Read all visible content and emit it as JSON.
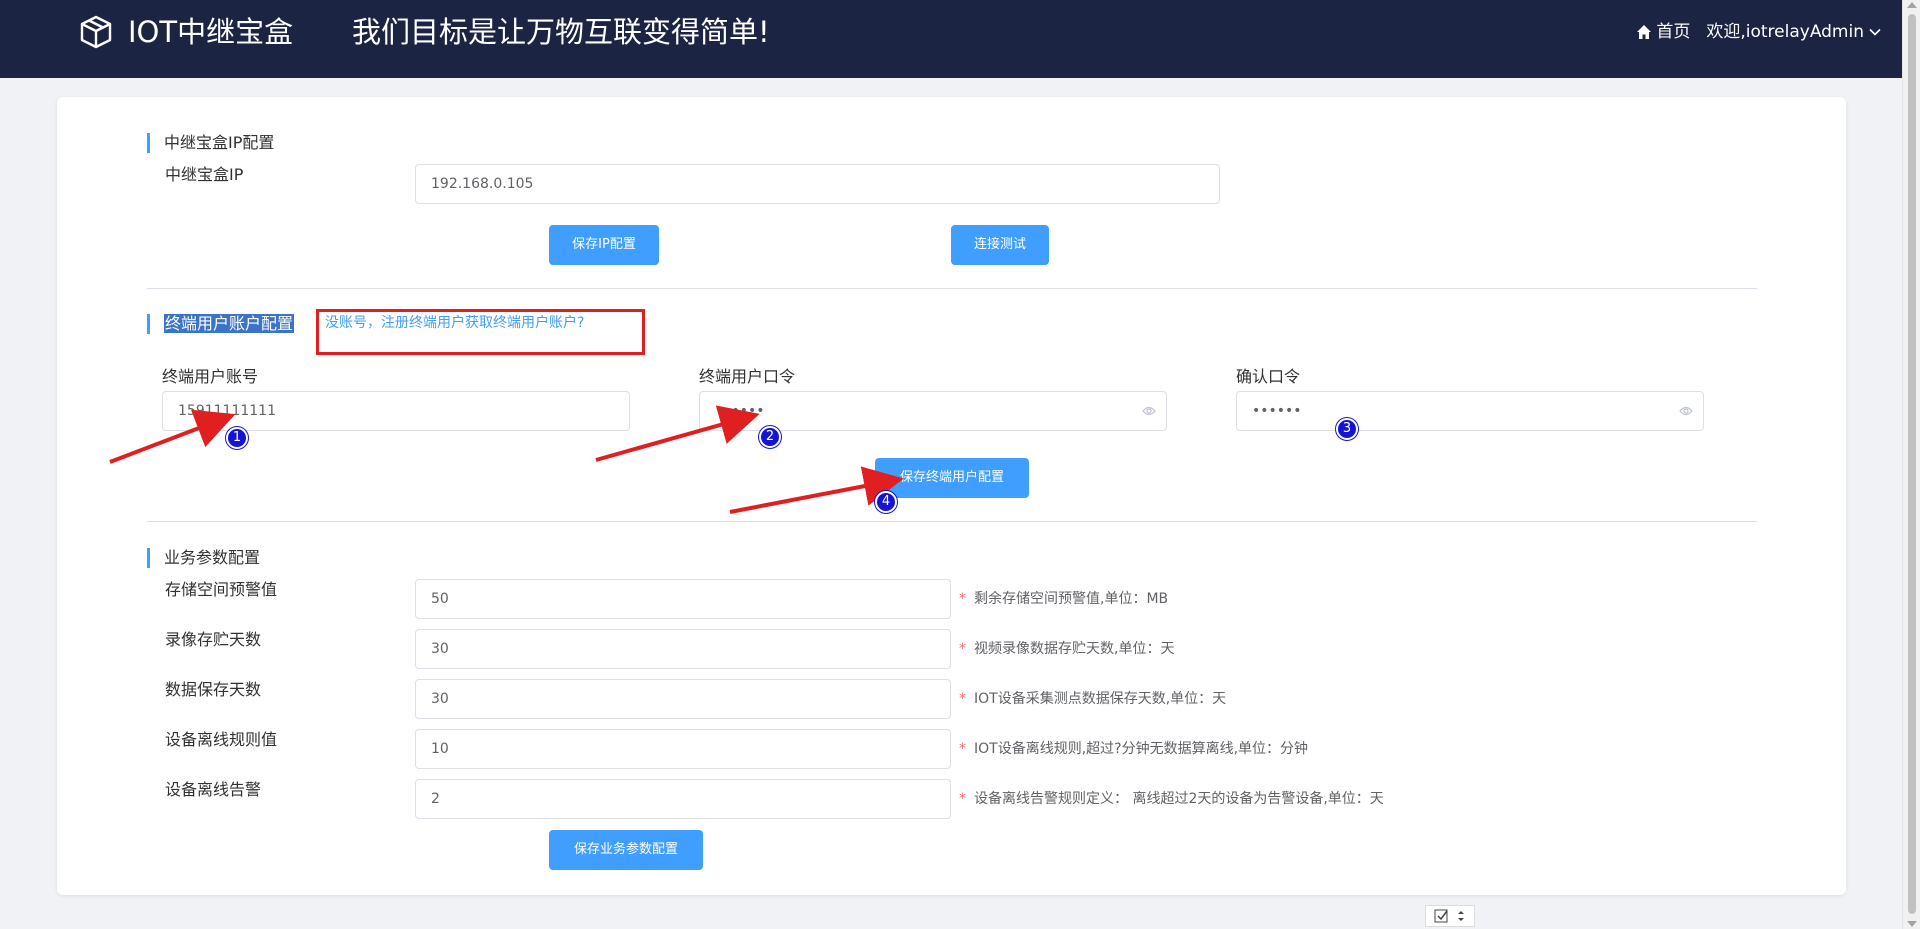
{
  "header": {
    "app_name": "IOT中继宝盒",
    "slogan": "我们目标是让万物互联变得简单!",
    "home_label": "首页",
    "user_label": "欢迎,iotrelayAdmin"
  },
  "ip_section": {
    "title": "中继宝盒IP配置",
    "ip_label": "中继宝盒IP",
    "ip_value": "192.168.0.105",
    "save_button": "保存IP配置",
    "test_button": "连接测试"
  },
  "account_section": {
    "title": "终端用户账户配置",
    "register_link": "没账号，注册终端用户获取终端用户账户?",
    "account_label": "终端用户账号",
    "account_value": "15911111111",
    "password_label": "终端用户口令",
    "password_value": "••••••",
    "confirm_label": "确认口令",
    "confirm_value": "••••••",
    "save_button": "保存终端用户配置"
  },
  "business_section": {
    "title": "业务参数配置",
    "rows": [
      {
        "label": "存储空间预警值",
        "value": "50",
        "hint": "剩余存储空间预警值,单位：MB"
      },
      {
        "label": "录像存贮天数",
        "value": "30",
        "hint": "视频录像数据存贮天数,单位：天"
      },
      {
        "label": "数据保存天数",
        "value": "30",
        "hint": "IOT设备采集测点数据保存天数,单位：天"
      },
      {
        "label": "设备离线规则值",
        "value": "10",
        "hint": "IOT设备离线规则,超过?分钟无数据算离线,单位：分钟"
      },
      {
        "label": "设备离线告警",
        "value": "2",
        "hint": "设备离线告警规则定义： 离线超过2天的设备为告警设备,单位：天"
      }
    ],
    "save_button": "保存业务参数配置"
  },
  "annotations": [
    "1",
    "2",
    "3",
    "4"
  ],
  "colors": {
    "header_bg": "#1c2444",
    "primary": "#409eff",
    "annotation_red": "#e02020",
    "badge_blue": "#1414d4"
  }
}
